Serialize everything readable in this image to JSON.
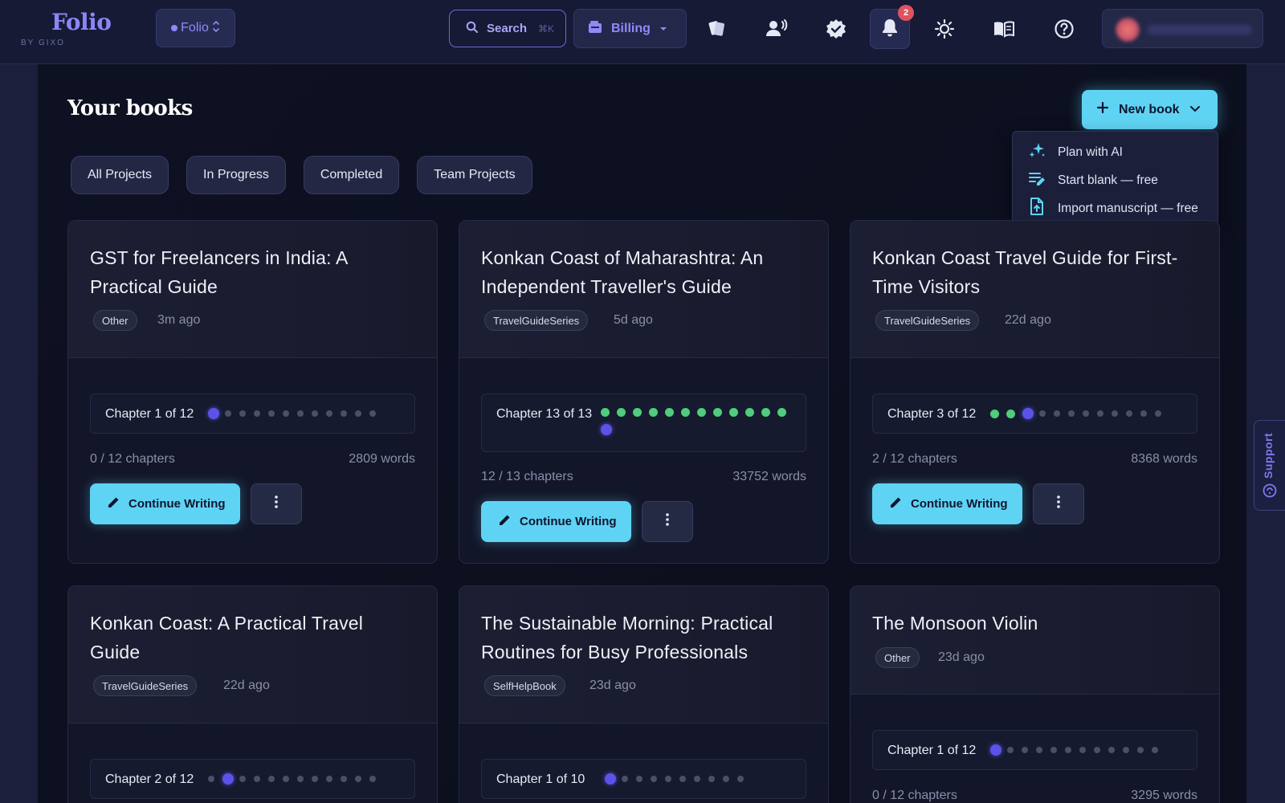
{
  "brand": {
    "name": "Folio",
    "sub": "BY GIXO"
  },
  "workspace": {
    "label": "Folio"
  },
  "search": {
    "label": "Search",
    "shortcut": "⌘K"
  },
  "billing": {
    "label": "Billing"
  },
  "notifications": {
    "count": "2"
  },
  "page": {
    "title": "Your books"
  },
  "new_book": {
    "label": "New book",
    "menu": [
      {
        "label": "Plan with AI",
        "icon": "sparkles-icon"
      },
      {
        "label": "Start blank — free",
        "icon": "edit-lines-icon"
      },
      {
        "label": "Import manuscript — free",
        "icon": "file-upload-icon"
      }
    ]
  },
  "filters": [
    "All Projects",
    "In Progress",
    "Completed",
    "Team Projects"
  ],
  "books": [
    {
      "title": "GST for Freelancers in India: A Practical Guide",
      "tag": "Other",
      "updated": "3m ago",
      "progress_label": "Chapter 1 of 12",
      "done": 0,
      "current": 1,
      "total": 12,
      "chapters": "0 / 12 chapters",
      "words": "2809 words",
      "button": "Continue Writing"
    },
    {
      "title": "Konkan Coast of Maharashtra: An Independent Traveller's Guide",
      "tag": "TravelGuideSeries",
      "updated": "5d ago",
      "progress_label": "Chapter 13 of 13",
      "done": 12,
      "current": 13,
      "total": 13,
      "chapters": "12 / 13 chapters",
      "words": "33752 words",
      "button": "Continue Writing"
    },
    {
      "title": "Konkan Coast Travel Guide for First-Time Visitors",
      "tag": "TravelGuideSeries",
      "updated": "22d ago",
      "progress_label": "Chapter 3 of 12",
      "done": 2,
      "current": 3,
      "total": 12,
      "chapters": "2 / 12 chapters",
      "words": "8368 words",
      "button": "Continue Writing"
    },
    {
      "title": "Konkan Coast: A Practical Travel Guide",
      "tag": "TravelGuideSeries",
      "updated": "22d ago",
      "progress_label": "Chapter 2 of 12",
      "done": 0,
      "current": 2,
      "total": 12
    },
    {
      "title": "The Sustainable Morning: Practical Routines for Busy Professionals",
      "tag": "SelfHelpBook",
      "updated": "23d ago",
      "progress_label": "Chapter 1 of 10",
      "done": 0,
      "current": 1,
      "total": 10
    },
    {
      "title": "The Monsoon Violin",
      "tag": "Other",
      "updated": "23d ago",
      "progress_label": "Chapter 1 of 12",
      "done": 0,
      "current": 1,
      "total": 12,
      "chapters": "0 / 12 chapters",
      "words": "3295 words"
    }
  ],
  "support": {
    "label": "Support"
  },
  "colors": {
    "accent": "#5fd3f3",
    "brand": "#8b86f7",
    "done": "#4fcc7c",
    "current": "#5b52e8"
  }
}
